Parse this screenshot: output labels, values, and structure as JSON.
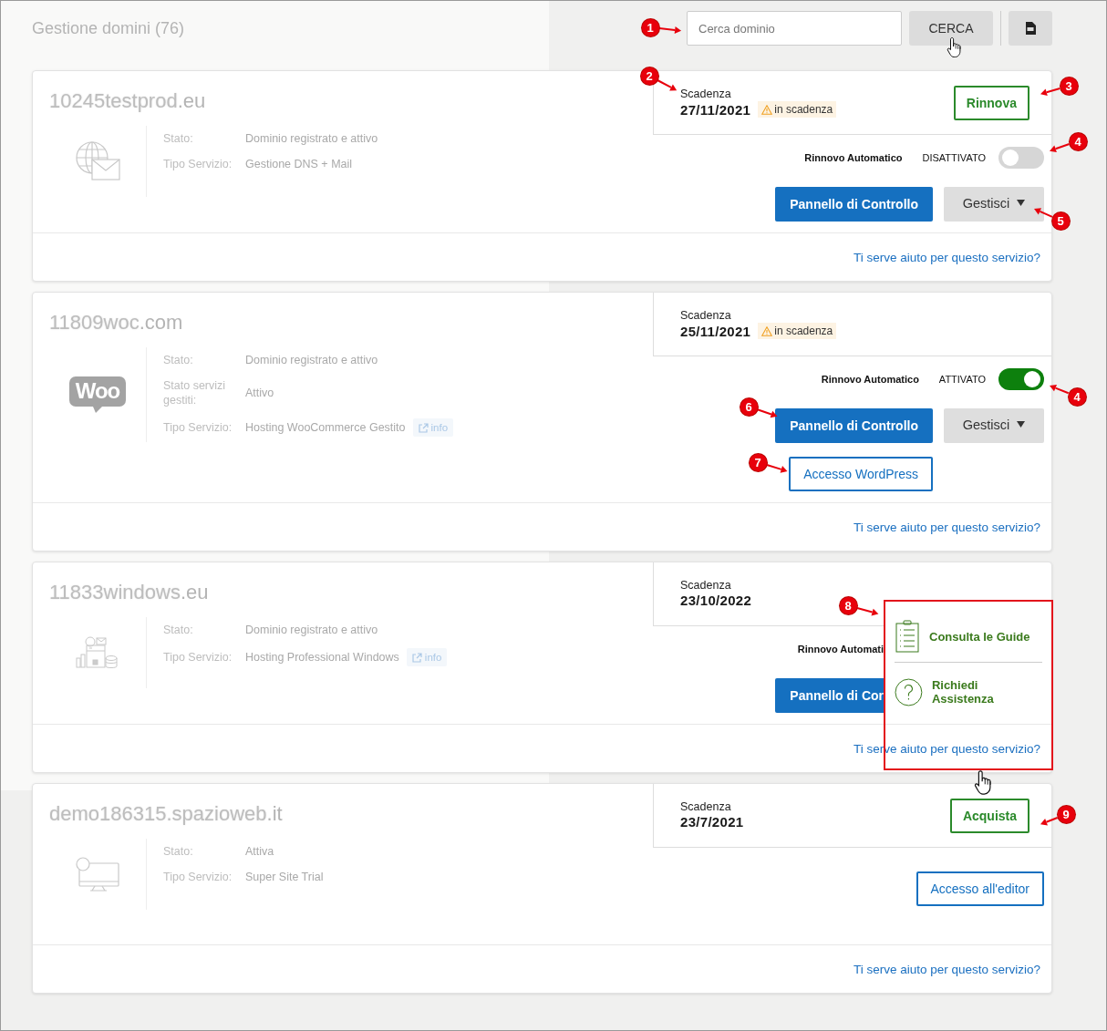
{
  "header": {
    "title": "Gestione domini (76)",
    "search": {
      "placeholder": "Cerca dominio"
    },
    "search_button": "CERCA"
  },
  "domains": [
    {
      "name_hidden": "10245testprod",
      "name_suffix": ".eu",
      "kind": "dns-mail",
      "details": [
        {
          "label": "Stato:",
          "value": "Dominio registrato e attivo"
        },
        {
          "label": "Tipo Servizio:",
          "value": "Gestione DNS + Mail"
        }
      ],
      "expiry": {
        "label": "Scadenza",
        "date": "27/11/2021",
        "badge": "in scadenza"
      },
      "expiry_action": "Rinnova",
      "auto_renew": {
        "label": "Rinnovo Automatico",
        "status": "DISATTIVATO",
        "on": false
      },
      "actions": [
        {
          "label": "Pannello di Controllo",
          "kind": "primary"
        },
        {
          "label": "Gestisci",
          "kind": "menu"
        }
      ],
      "help_link": "Ti serve aiuto per questo servizio?"
    },
    {
      "name_hidden": "11809woc",
      "name_suffix": ".com",
      "kind": "woo",
      "logo_text": "Woo",
      "details": [
        {
          "label": "Stato:",
          "value": "Dominio registrato e attivo"
        },
        {
          "label": "Stato servizi gestiti:",
          "value": "Attivo"
        },
        {
          "label": "Tipo Servizio:",
          "value": "Hosting WooCommerce Gestito",
          "info": "info"
        }
      ],
      "expiry": {
        "label": "Scadenza",
        "date": "25/11/2021",
        "badge": "in scadenza"
      },
      "auto_renew": {
        "label": "Rinnovo Automatico",
        "status": "ATTIVATO",
        "on": true
      },
      "actions": [
        {
          "label": "Pannello di Controllo",
          "kind": "primary"
        },
        {
          "label": "Gestisci",
          "kind": "menu"
        },
        {
          "label": "Accesso WordPress",
          "kind": "outline"
        }
      ],
      "help_link": "Ti serve aiuto per questo servizio?"
    },
    {
      "name_hidden": "11833windows",
      "name_suffix": ".eu",
      "kind": "windows-hosting",
      "details": [
        {
          "label": "Stato:",
          "value": "Dominio registrato e attivo"
        },
        {
          "label": "Tipo Servizio:",
          "value": "Hosting Professional Windows",
          "info": "info"
        }
      ],
      "expiry": {
        "label": "Scadenza",
        "date": "23/10/2022"
      },
      "auto_renew": {
        "label": "Rinnovo Automati"
      },
      "actions": [
        {
          "label": "Pannello di Cor",
          "kind": "primary"
        }
      ],
      "help_link": "Ti serve aiuto per questo servizio?",
      "help_popup": {
        "items": [
          {
            "label": "Consulta le Guide",
            "kind": "guide"
          },
          {
            "label": "Richiedi Assistenza",
            "kind": "support"
          }
        ]
      }
    },
    {
      "name_hidden": "demo186315.spazioweb",
      "name_suffix": ".it",
      "kind": "site-builder",
      "details": [
        {
          "label": "Stato:",
          "value": "Attiva"
        },
        {
          "label": "Tipo Servizio:",
          "value": "Super Site Trial"
        }
      ],
      "expiry": {
        "label": "Scadenza",
        "date": "23/7/2021"
      },
      "expiry_action": "Acquista",
      "actions": [
        {
          "label": "Accesso all'editor",
          "kind": "outline"
        }
      ],
      "help_link": "Ti serve aiuto per questo servizio?"
    }
  ],
  "callouts": [
    "1",
    "2",
    "3",
    "4",
    "5",
    "4",
    "6",
    "7",
    "8",
    "9"
  ]
}
